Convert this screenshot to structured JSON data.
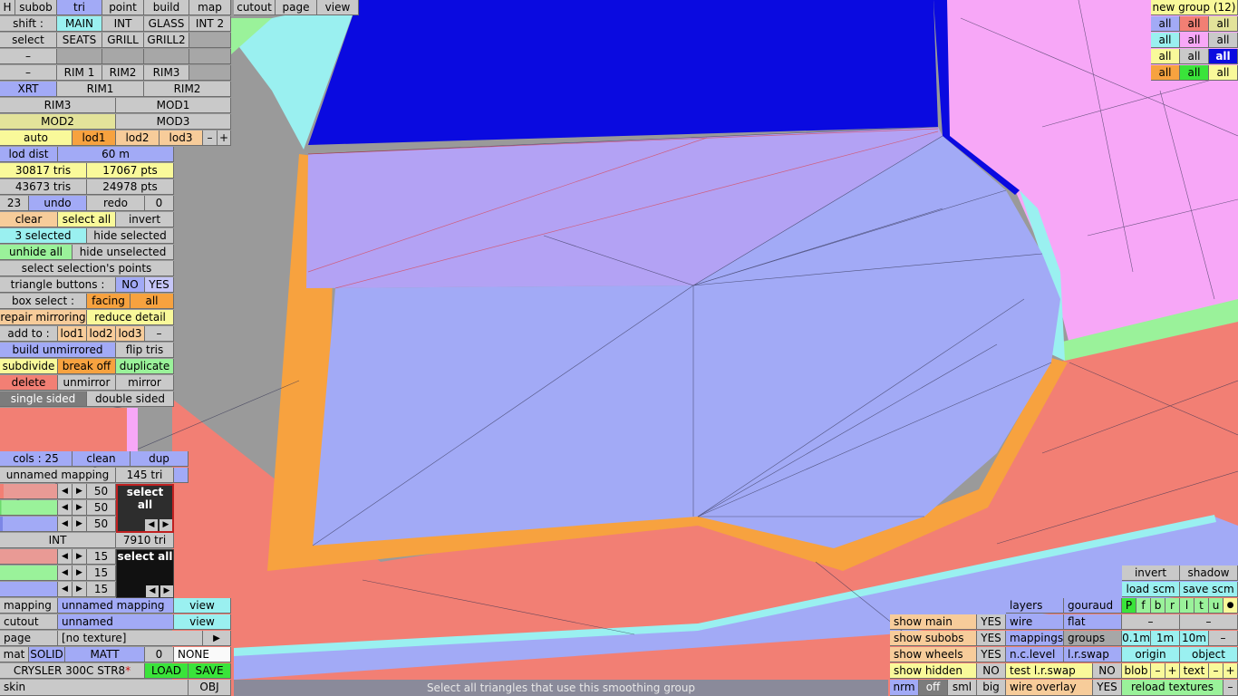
{
  "toolbar": {
    "h": "H",
    "subob": "subob",
    "tri": "tri",
    "point": "point",
    "build": "build",
    "map": "map",
    "cutout": "cutout",
    "page": "page",
    "view": "view"
  },
  "left": {
    "shift": "shift :",
    "main": "MAIN",
    "int": "INT",
    "glass": "GLASS",
    "int2": "INT 2",
    "select": "select",
    "seats": "SEATS",
    "grill": "GRILL",
    "grill2": "GRILL2",
    "dash": "–",
    "rim1": "RIM 1",
    "rim2": "RIM2",
    "rim3": "RIM3",
    "xrt": "XRT",
    "rim1b": "RIM1",
    "rim2b": "RIM2",
    "rim3b": "RIM3",
    "mod1": "MOD1",
    "mod2": "MOD2",
    "mod3": "MOD3",
    "auto": "auto",
    "lod1": "lod1",
    "lod2": "lod2",
    "lod3": "lod3",
    "minus": "–",
    "plus": "+",
    "lod_dist": "lod dist",
    "lod_dist_val": "60 m",
    "tris1": "30817 tris",
    "pts1": "17067 pts",
    "tris2": "43673 tris",
    "pts2": "24978 pts",
    "undo_count": "23",
    "undo": "undo",
    "redo": "redo",
    "redo_count": "0",
    "clear": "clear",
    "select_all": "select all",
    "invert": "invert",
    "selected": "3 selected",
    "hide_selected": "hide selected",
    "unhide_all": "unhide all",
    "hide_unselected": "hide unselected",
    "select_points": "select selection's points",
    "triangle_buttons": "triangle buttons :",
    "no": "NO",
    "yes": "YES",
    "box_select": "box select :",
    "facing": "facing",
    "all": "all",
    "repair_mirroring": "repair mirroring",
    "reduce_detail": "reduce detail",
    "add_to": "add to :",
    "build_unmirrored": "build unmirrored",
    "flip_tris": "flip tris",
    "subdivide": "subdivide",
    "break_off": "break off",
    "duplicate": "duplicate",
    "delete": "delete",
    "unmirror": "unmirror",
    "mirror": "mirror",
    "single_sided": "single sided",
    "double_sided": "double sided"
  },
  "mapping_panel": {
    "cols": "cols : 25",
    "clean": "clean",
    "dup": "dup",
    "m1_name": "unnamed mapping",
    "m1_tri": "145 tri",
    "v50a": "50",
    "v50b": "50",
    "v50c": "50",
    "select_all": "select all",
    "m2_name": "INT",
    "m2_tri": "7910 tri",
    "v15a": "15",
    "v15b": "15",
    "v15c": "15",
    "slider_values": [
      0.06,
      0.02,
      0.05,
      0.02,
      0.0,
      0.0
    ],
    "arrow_left": "◀",
    "arrow_right": "▶"
  },
  "bottom_left": {
    "mapping": "mapping",
    "mapping_val": "unnamed mapping",
    "view": "view",
    "cutout": "cutout",
    "cutout_val": "unnamed",
    "page": "page",
    "page_val": "[no texture]",
    "play": "▶",
    "mat": "mat",
    "solid": "SOLID",
    "matt": "MATT",
    "zero": "0",
    "none": "NONE",
    "model": "CRYSLER 300C STR8",
    "star": "*",
    "load": "LOAD",
    "save": "SAVE",
    "skin": "skin",
    "obj": "OBJ"
  },
  "groups": {
    "title": "new group (12)",
    "all": "all"
  },
  "bottom_right": {
    "show_main": "show main",
    "show_subobs": "show subobs",
    "show_wheels": "show wheels",
    "show_hidden": "show hidden",
    "yes": "YES",
    "no": "NO",
    "nrm": "nrm",
    "off": "off",
    "sml": "sml",
    "big": "big",
    "layers": "layers",
    "gouraud": "gouraud",
    "wire": "wire",
    "flat": "flat",
    "mappings": "mappings",
    "groups": "groups",
    "nc_level": "n.c.level",
    "lr_swap": "l.r.swap",
    "test_lr_swap": "test l.r.swap",
    "wire_overlay": "wire overlay",
    "invert": "invert",
    "shadow": "shadow",
    "load_scm": "load scm",
    "save_scm": "save scm",
    "flags": [
      "P",
      "f",
      "b",
      "r",
      "l",
      "t",
      "u",
      "●"
    ],
    "dash": "–",
    "d01": "0.1m",
    "d1": "1m",
    "d10": "10m",
    "origin": "origin",
    "object": "object",
    "blob": "blob",
    "minus": "–",
    "plus": "+",
    "text": "text",
    "reload_textures": "reload textures"
  },
  "status": "Select all triangles that use this smoothing group",
  "colors": {
    "blue_face": "#a2aaf6",
    "lavender_face": "#b3a2f4",
    "salmon": "#f27f74",
    "orange": "#f7a23f",
    "pink": "#f7a7f7",
    "cyan": "#9af0f0",
    "dark_blue": "#0a0ae0",
    "green": "#9af29a"
  }
}
